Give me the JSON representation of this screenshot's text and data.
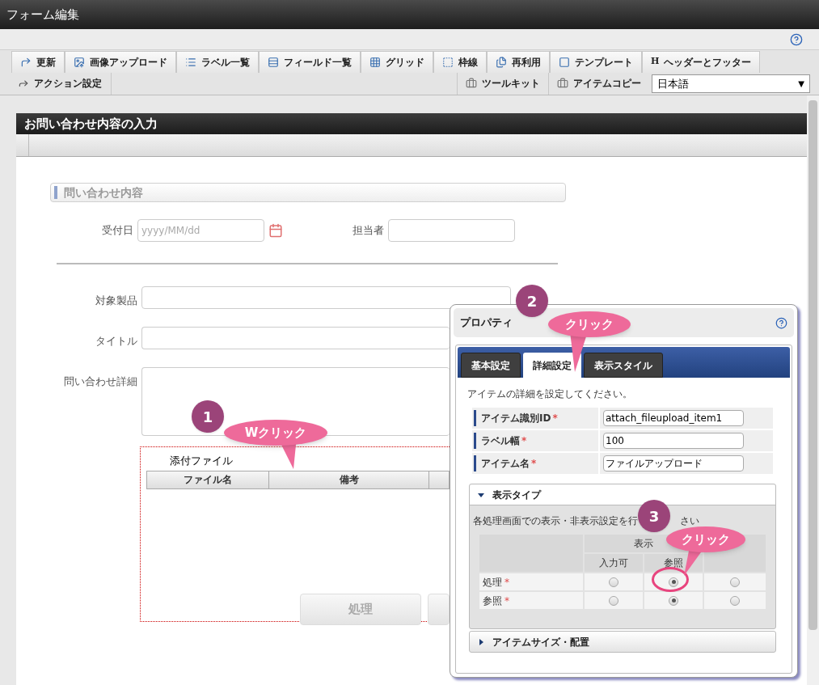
{
  "window": {
    "title": "フォーム編集"
  },
  "toolbar": {
    "row_1": [
      {
        "label": "更新"
      },
      {
        "label": "画像アップロード"
      },
      {
        "label": "ラベル一覧"
      },
      {
        "label": "フィールド一覧"
      },
      {
        "label": "グリッド"
      },
      {
        "label": "枠線"
      },
      {
        "label": "再利用"
      },
      {
        "label": "テンプレート"
      },
      {
        "label": "ヘッダーとフッター",
        "glyph": "H"
      }
    ],
    "row_2_left": [
      {
        "label": "アクション設定"
      }
    ],
    "row_2_right": [
      {
        "label": "ツールキット"
      },
      {
        "label": "アイテムコピー"
      }
    ],
    "language_select": {
      "value": "日本語",
      "arrow": "▼"
    }
  },
  "form": {
    "title": "お問い合わせ内容の入力",
    "section": "問い合わせ内容",
    "date_field": {
      "label": "受付日",
      "placeholder": "yyyy/MM/dd"
    },
    "assignee_field": {
      "label": "担当者"
    },
    "fields": [
      {
        "label": "対象製品",
        "kind": "input"
      },
      {
        "label": "タイトル",
        "kind": "input"
      },
      {
        "label": "問い合わせ詳細",
        "kind": "textarea"
      }
    ],
    "attachment": {
      "title": "添付ファイル",
      "columns": [
        "ファイル名",
        "備考"
      ],
      "buttons": [
        {
          "label": "処理",
          "disabled": true
        }
      ]
    }
  },
  "properties": {
    "title": "プロパティ",
    "tabs": [
      {
        "label": "基本設定",
        "selected": false
      },
      {
        "label": "詳細設定",
        "selected": true
      },
      {
        "label": "表示スタイル",
        "selected": false
      }
    ],
    "description": "アイテムの詳細を設定してください。",
    "fields": [
      {
        "label": "アイテム識別ID",
        "mark": "*",
        "value": "attach_fileupload_item1"
      },
      {
        "label": "ラベル幅",
        "mark": "*",
        "value": "100"
      },
      {
        "label": "アイテム名",
        "mark": "*",
        "value": "ファイルアップロード"
      }
    ],
    "sections": [
      {
        "title": "表示タイプ",
        "expanded": true,
        "description_parts": [
          "各処理画面での表示・非表示設定を行",
          "さい"
        ],
        "group_header": "表示",
        "columns": [
          "入力可",
          "参照"
        ],
        "rows": [
          {
            "label": "処理",
            "mark": "*",
            "options": [
              {
                "selected": false
              },
              {
                "selected": true
              },
              {
                "selected": false
              }
            ]
          },
          {
            "label": "参照",
            "mark": "*",
            "options": [
              {
                "selected": false
              },
              {
                "selected": true
              },
              {
                "selected": false
              }
            ]
          }
        ]
      },
      {
        "title": "アイテムサイズ・配置",
        "expanded": false
      }
    ]
  },
  "callouts": [
    {
      "number": "1",
      "text": "Wクリック"
    },
    {
      "number": "2",
      "text": "クリック"
    },
    {
      "number": "3",
      "text": "クリック"
    }
  ]
}
